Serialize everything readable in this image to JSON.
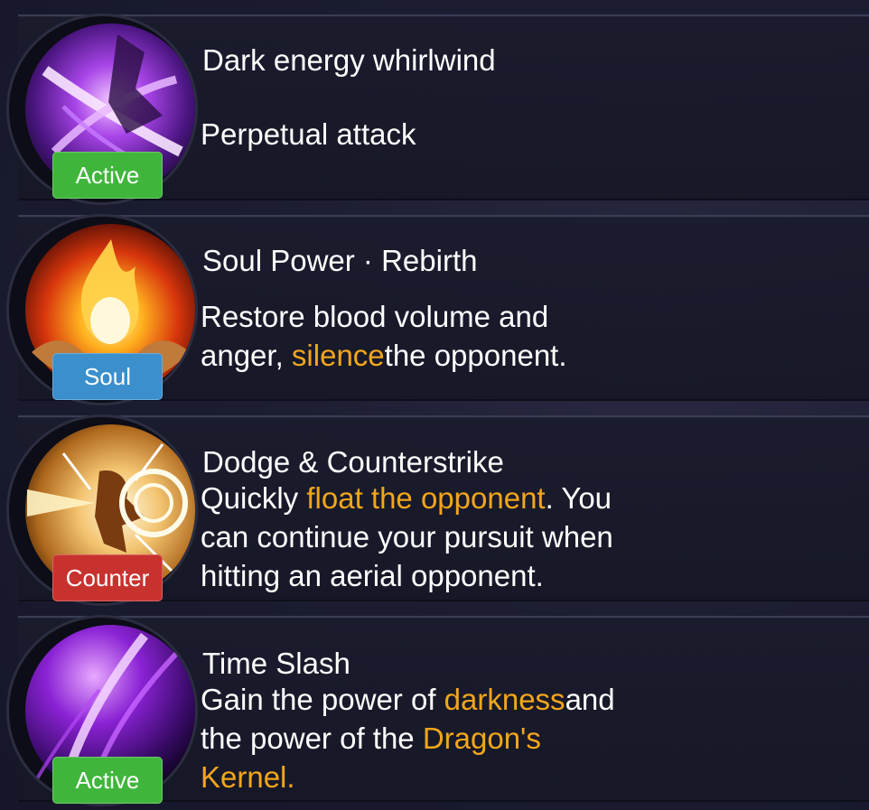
{
  "skills": [
    {
      "name": "Dark energy whirlwind",
      "badge": "Active",
      "icon": "dark-whirlwind-icon",
      "desc": "Perpetual attack"
    },
    {
      "name": "Soul Power · Rebirth",
      "badge": "Soul",
      "icon": "flame-in-hands-icon",
      "desc_1": "Restore blood volume and",
      "desc_2a": "anger, ",
      "desc_2b": "silence",
      "desc_2c": "the opponent."
    },
    {
      "name": "Dodge & Counterstrike",
      "badge": "Counter",
      "icon": "counterstrike-icon",
      "desc_1a": "Quickly ",
      "desc_1b": "float the opponent",
      "desc_1c": ". You",
      "desc_2": "can continue your pursuit when",
      "desc_3": "hitting an aerial opponent."
    },
    {
      "name": "Time Slash",
      "badge": "Active",
      "icon": "purple-slash-icon",
      "desc_1a": "Gain the power of ",
      "desc_1b": "darkness",
      "desc_1c": "and",
      "desc_2a": "the power of the ",
      "desc_2b": "Dragon's",
      "desc_3": "Kernel."
    }
  ],
  "colors": {
    "highlight": "#f2a61b",
    "badge_active": "#3fb63b",
    "badge_soul": "#3a8fcc",
    "badge_counter": "#c8322e"
  }
}
